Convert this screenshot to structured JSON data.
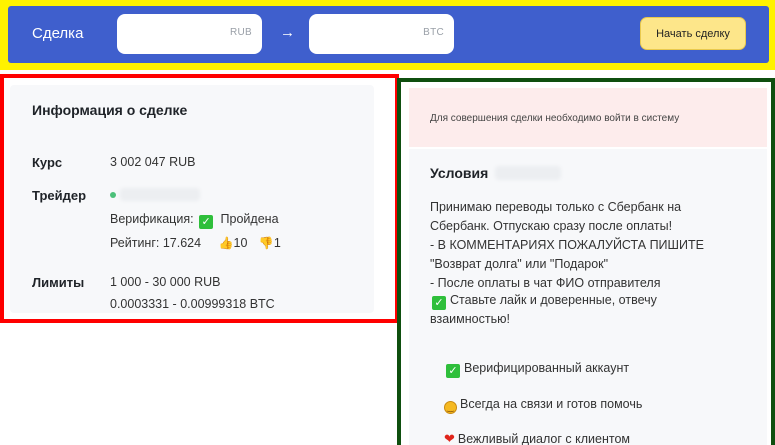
{
  "header": {
    "title": "Сделка",
    "rub_suffix": "RUB",
    "btc_suffix": "BTC",
    "arrow": "→",
    "start_button": "Начать сделку"
  },
  "deal_info": {
    "title": "Информация о сделке",
    "rate_label": "Курс",
    "rate_value": "3 002 047 RUB",
    "trader_label": "Трейдер",
    "verification_label": "Верификация:",
    "verification_value": "Пройдена",
    "rating_label": "Рейтинг: 17.624",
    "likes": "10",
    "dislikes": "1",
    "limits_label": "Лимиты",
    "limits_rub": "1 000 - 30 000 RUB",
    "limits_btc": "0.0003331 - 0.00999318 BTC"
  },
  "alert": {
    "text": "Для совершения сделки необходимо войти в систему"
  },
  "conditions": {
    "title": "Условия",
    "text": "Принимаю переводы только с Сбербанк на\nСбербанк. Отпускаю сразу после оплаты!\n- В КОММЕНТАРИЯХ ПОЖАЛУЙСТА ПИШИТЕ\n\"Возврат долга\" или \"Подарок\"\n- После оплаты в чат ФИО отправителя",
    "like_line_1": "Ставьте лайк и доверенные, отвечу",
    "like_line_2": "взаимностью!",
    "features": {
      "verified": "Верифицированный аккаунт",
      "always_online": "Всегда на связи и готов помочь",
      "polite": "Вежливый диалог с клиентом"
    }
  },
  "icons": {
    "check": "✓",
    "heart": "❤",
    "thumb_up": "👍",
    "thumb_down": "👎"
  },
  "colors": {
    "header_blue": "#3f5fcd",
    "button_yellow": "#fde68a",
    "check_green": "#2fbf3b",
    "online_green": "#4cc07a",
    "alert_pink": "#fdecec"
  }
}
